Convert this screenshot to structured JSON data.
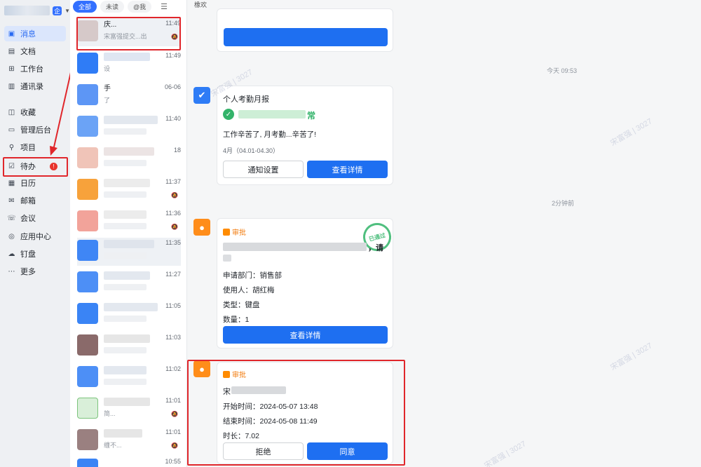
{
  "nav": {
    "badge": "企",
    "items": [
      {
        "label": "消息",
        "icon": "chat-bubble-icon"
      },
      {
        "label": "文档",
        "icon": "document-icon"
      },
      {
        "label": "工作台",
        "icon": "grid-icon"
      },
      {
        "label": "通讯录",
        "icon": "contacts-book-icon"
      },
      {
        "label": "收藏",
        "icon": "folder-star-icon"
      },
      {
        "label": "管理后台",
        "icon": "monitor-icon"
      },
      {
        "label": "项目",
        "icon": "project-icon"
      },
      {
        "label": "待办",
        "icon": "todo-check-icon",
        "badge": "!"
      },
      {
        "label": "日历",
        "icon": "calendar-icon"
      },
      {
        "label": "邮箱",
        "icon": "mail-icon"
      },
      {
        "label": "会议",
        "icon": "meeting-phone-icon"
      },
      {
        "label": "应用中心",
        "icon": "app-center-icon"
      },
      {
        "label": "钉盘",
        "icon": "cloud-drive-icon"
      },
      {
        "label": "更多",
        "icon": "more-dots-icon"
      }
    ]
  },
  "filters": [
    "全部",
    "未读",
    "@我"
  ],
  "chats": [
    {
      "time": "11:49",
      "title": "庆...",
      "preview": "宋富强提交...出",
      "muted": true
    },
    {
      "time": "11:49",
      "preview": "设"
    },
    {
      "time": "06-06",
      "title": "手",
      "preview": "了"
    },
    {
      "time": "11:40"
    },
    {
      "time": "18"
    },
    {
      "time": "11:37",
      "muted": true
    },
    {
      "time": "11:36",
      "muted": true
    },
    {
      "time": "11:35"
    },
    {
      "time": "11:27"
    },
    {
      "time": "11:05"
    },
    {
      "time": "11:03"
    },
    {
      "time": "11:02"
    },
    {
      "time": "11:01",
      "preview": "简..."
    },
    {
      "time": "11:01",
      "preview": "缠不..."
    },
    {
      "time": "10:55"
    }
  ],
  "main": {
    "topbar": "橡欢",
    "ts1": "今天 09:53",
    "ts2": "2分钟前",
    "attendance": {
      "title": "个人考勤月报",
      "status_suffix": "常",
      "message": "工作辛苦了, 月考勤...辛苦了!",
      "period": "4月（04.01-04.30）",
      "btn_settings": "通知设置",
      "btn_detail": "查看详情"
    },
    "approval1": {
      "tag": "审批",
      "heading_suffix": "，请",
      "stamp": "已通过",
      "fields": [
        "申请部门：销售部",
        "使用人：胡红梅",
        "类型：键盘",
        "数量：1"
      ],
      "btn_detail": "查看详情"
    },
    "approval2": {
      "tag": "审批",
      "prefix": "宋",
      "fields": [
        "开始时间：2024-05-07 13:48",
        "结束时间：2024-05-08 11:49",
        "时长：7.02"
      ],
      "btn_reject": "拒绝",
      "btn_agree": "同意"
    },
    "watermark": "宋富强 | 3027"
  }
}
